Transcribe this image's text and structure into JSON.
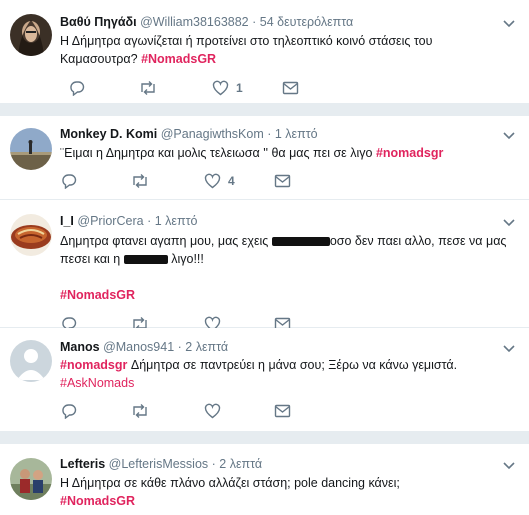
{
  "tweets": [
    {
      "name": "Βαθύ Πηγάδι",
      "handle": "@William38163882",
      "time": "· 54 δευτερόλεπτα",
      "text1": "Η Δήμητρα αγωνίζεται ή προτείνει στο τηλεοπτικό κοινό στάσεις του",
      "text2": "Καμασουτρα?",
      "hashtag": "#NomadsGR",
      "likes": "1"
    },
    {
      "name": "Monkey D. Komi",
      "handle": "@PanagiwthsKom",
      "time": "· 1 λεπτό",
      "text1": "¨Ειμαι η Δημητρα και μολις τελειωσα '' θα μας πει σε λιγο",
      "hashtag": "#nomadsgr",
      "likes": "4"
    },
    {
      "name": "I_I",
      "handle": "@PriorCera",
      "time": "· 1 λεπτό",
      "text1a": "Δημητρα φτανει αγαπη μου, μας εχεις",
      "text1b": "οσο δεν παει αλλο, πεσε να μας",
      "text2a": "πεσει και η",
      "text2b": "λιγο!!!",
      "hashtag": "#NomadsGR"
    },
    {
      "name": "Manos",
      "handle": "@Manos941",
      "time": "· 2 λεπτά",
      "hashtag": "#nomadsgr",
      "text1": "Δήμητρα σε παντρεύει η μάνα σου; Ξέρω να κάνω γεμιστά.",
      "hashtag2": "#AskNomads"
    },
    {
      "name": "Lefteris",
      "handle": "@LefterisMessios",
      "time": "· 2 λεπτά",
      "text1": "Η Δήμητρα σε κάθε πλάνο αλλάζει στάση; pole dancing κάνει;",
      "hashtag": "#NomadsGR"
    }
  ],
  "icons": [
    "reply-icon",
    "retweet-icon",
    "like-icon",
    "message-icon",
    "chevron-down-icon"
  ],
  "colors": {
    "hashtag": "#e0245e",
    "secondary": "#657786",
    "divider": "#e6ecf0"
  }
}
